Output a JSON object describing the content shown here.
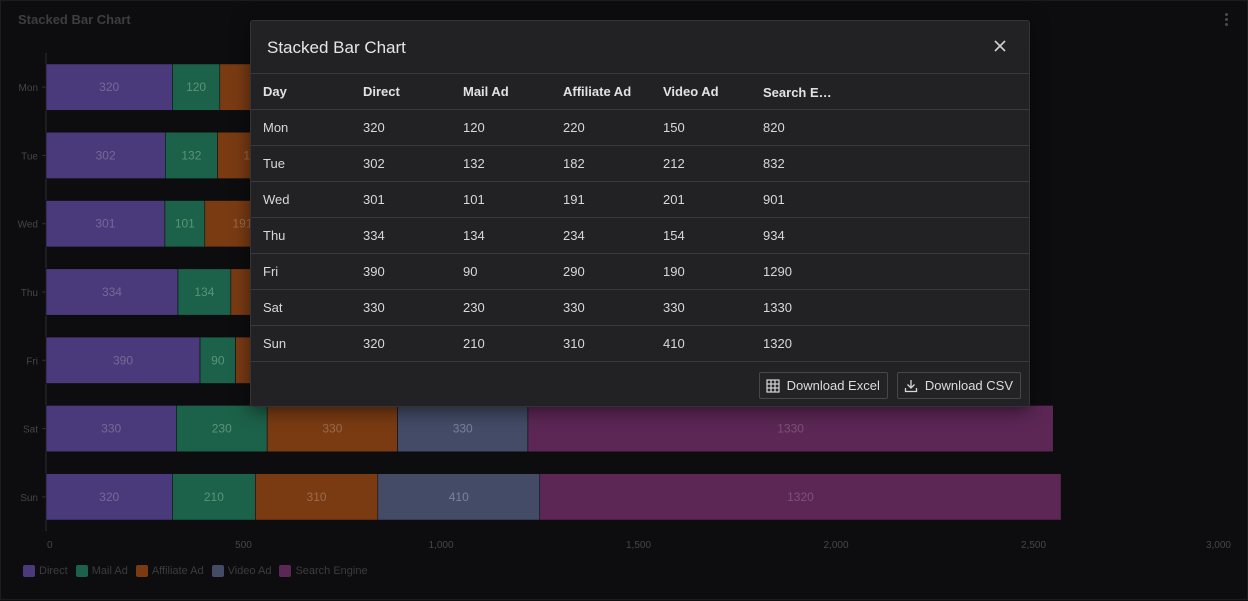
{
  "panel": {
    "title": "Stacked Bar Chart",
    "menu_icon": "kebab-menu-icon"
  },
  "chart_data": {
    "type": "bar",
    "orientation": "horizontal",
    "stacked": true,
    "categories": [
      "Mon",
      "Tue",
      "Wed",
      "Thu",
      "Fri",
      "Sat",
      "Sun"
    ],
    "series": [
      {
        "name": "Direct",
        "color": "#4a3a7c",
        "values": [
          320,
          302,
          301,
          334,
          390,
          330,
          320
        ]
      },
      {
        "name": "Mail Ad",
        "color": "#1c6149",
        "values": [
          120,
          132,
          101,
          134,
          90,
          230,
          210
        ]
      },
      {
        "name": "Affiliate Ad",
        "color": "#7a3b13",
        "values": [
          220,
          182,
          191,
          234,
          290,
          330,
          310
        ]
      },
      {
        "name": "Video Ad",
        "color": "#434b66",
        "values": [
          150,
          212,
          201,
          154,
          190,
          330,
          410
        ]
      },
      {
        "name": "Search Engine",
        "color": "#5c2755",
        "values": [
          820,
          832,
          901,
          934,
          1290,
          1330,
          1320
        ]
      }
    ],
    "xlim": [
      0,
      3000
    ],
    "x_ticks": [
      "0",
      "500",
      "1,000",
      "1,500",
      "2,000",
      "2,500",
      "3,000"
    ],
    "x_tick_values": [
      0,
      500,
      1000,
      1500,
      2000,
      2500,
      3000
    ],
    "legend_position": "bottom-left",
    "grid": false,
    "data_labels": true
  },
  "modal": {
    "title": "Stacked Bar Chart",
    "close_icon": "close-icon",
    "columns": [
      "Day",
      "Direct",
      "Mail Ad",
      "Affiliate Ad",
      "Video Ad",
      "Search En..."
    ],
    "rows": [
      [
        "Mon",
        "320",
        "120",
        "220",
        "150",
        "820"
      ],
      [
        "Tue",
        "302",
        "132",
        "182",
        "212",
        "832"
      ],
      [
        "Wed",
        "301",
        "101",
        "191",
        "201",
        "901"
      ],
      [
        "Thu",
        "334",
        "134",
        "234",
        "154",
        "934"
      ],
      [
        "Fri",
        "390",
        "90",
        "290",
        "190",
        "1290"
      ],
      [
        "Sat",
        "330",
        "230",
        "330",
        "330",
        "1330"
      ],
      [
        "Sun",
        "320",
        "210",
        "310",
        "410",
        "1320"
      ]
    ],
    "download_excel_label": "Download Excel",
    "download_csv_label": "Download CSV",
    "excel_icon": "table-grid-icon",
    "csv_icon": "download-icon"
  }
}
